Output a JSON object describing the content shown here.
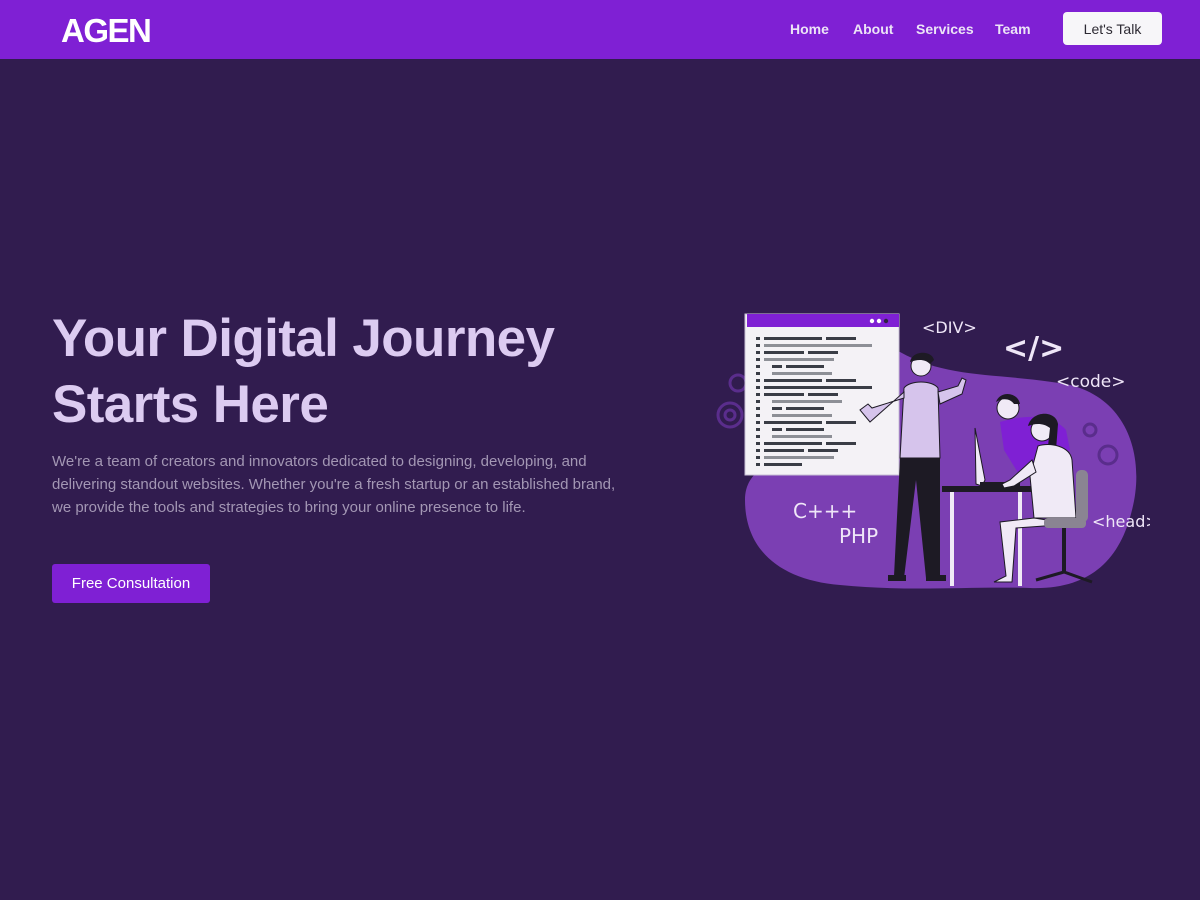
{
  "brand": {
    "logo_text": "AGEN"
  },
  "nav": {
    "items": [
      {
        "label": "Home"
      },
      {
        "label": "About"
      },
      {
        "label": "Services"
      },
      {
        "label": "Team"
      }
    ],
    "cta_label": "Let's Talk"
  },
  "hero": {
    "title_lines": [
      "Your Digital Journey",
      "Starts Here"
    ],
    "description_lines": [
      "We're a team of creators and innovators dedicated to designing, developing, and",
      "delivering standout websites. Whether you're a fresh startup or an established brand,",
      "we provide the tools and strategies to bring your online presence to life."
    ],
    "button_label": "Free Consultation"
  },
  "illustration": {
    "labels": {
      "div": "<DIV>",
      "code_tag": "</>",
      "code": "<code>",
      "cpp": "C+++",
      "php": "PHP",
      "head": "<head>"
    }
  },
  "colors": {
    "background": "#311c4f",
    "accent": "#7f20d4",
    "title": "#dccbf1",
    "body_text": "#a397b4",
    "illustration_purple": "#7b3fb3"
  }
}
